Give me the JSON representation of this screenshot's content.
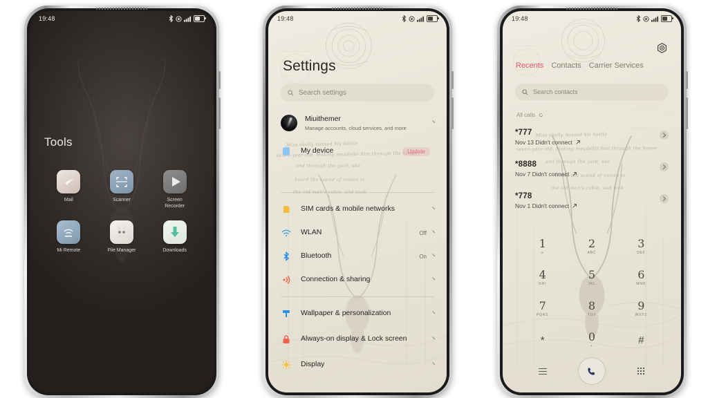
{
  "status_bar": {
    "time": "19:48",
    "icons": [
      "bluetooth-icon",
      "dnd-icon",
      "signal-icon",
      "battery-icon"
    ]
  },
  "phone1": {
    "folder_title": "Tools",
    "apps": [
      {
        "label": "Mail",
        "icon": "mail-icon"
      },
      {
        "label": "Scanner",
        "icon": "scanner-icon"
      },
      {
        "label": "Screen Recorder",
        "icon": "screen-recorder-icon"
      },
      {
        "label": "Mi Remote",
        "icon": "mi-remote-icon"
      },
      {
        "label": "File Manager",
        "icon": "file-manager-icon"
      },
      {
        "label": "Downloads",
        "icon": "downloads-icon"
      }
    ]
  },
  "phone2": {
    "title": "Settings",
    "search_placeholder": "Search settings",
    "account": {
      "name": "Miuithemer",
      "subtitle": "Manage accounts, cloud services, and more"
    },
    "items": [
      {
        "label": "My device",
        "badge": "Update",
        "value": "",
        "icon": "device-icon",
        "color": "#8cc6f0"
      },
      {
        "label": "SIM cards & mobile networks",
        "badge": "",
        "value": "",
        "icon": "sim-icon",
        "color": "#f6bd3b"
      },
      {
        "label": "WLAN",
        "badge": "",
        "value": "Off",
        "icon": "wifi-icon",
        "color": "#4aa8e0"
      },
      {
        "label": "Bluetooth",
        "badge": "",
        "value": "On",
        "icon": "bluetooth-icon",
        "color": "#2b8fe8"
      },
      {
        "label": "Connection & sharing",
        "badge": "",
        "value": "",
        "icon": "connection-sharing-icon",
        "color": "#ef5a3c"
      },
      {
        "label": "Wallpaper & personalization",
        "badge": "",
        "value": "",
        "icon": "wallpaper-icon",
        "color": "#2b8fe8"
      },
      {
        "label": "Always-on display & Lock screen",
        "badge": "",
        "value": "",
        "icon": "lock-icon",
        "color": "#f0614b"
      },
      {
        "label": "Display",
        "badge": "",
        "value": "",
        "icon": "display-icon",
        "color": "#f7c13a"
      }
    ]
  },
  "phone3": {
    "tabs": [
      {
        "label": "Recents",
        "active": true
      },
      {
        "label": "Contacts",
        "active": false
      },
      {
        "label": "Carrier Services",
        "active": false
      }
    ],
    "search_placeholder": "Search contacts",
    "filter_label": "All calls",
    "calls": [
      {
        "number": "*777",
        "detail": "Nov 13 Didn't connect"
      },
      {
        "number": "*8888",
        "detail": "Nov 7 Didn't connect"
      },
      {
        "number": "*778",
        "detail": "Nov 1 Didn't connect"
      }
    ],
    "dialpad": [
      {
        "digit": "1",
        "letters": "∞"
      },
      {
        "digit": "2",
        "letters": "ABC"
      },
      {
        "digit": "3",
        "letters": "DEF"
      },
      {
        "digit": "4",
        "letters": "GHI"
      },
      {
        "digit": "5",
        "letters": "JKL"
      },
      {
        "digit": "6",
        "letters": "MNO"
      },
      {
        "digit": "7",
        "letters": "PQRS"
      },
      {
        "digit": "8",
        "letters": "TUV"
      },
      {
        "digit": "9",
        "letters": "WXYZ"
      },
      {
        "digit": "*",
        "letters": ""
      },
      {
        "digit": "0",
        "letters": "+"
      },
      {
        "digit": "#",
        "letters": ""
      }
    ],
    "bottom_bar": {
      "menu": "menu-icon",
      "call": "call-icon",
      "keypad": "keypad-icon"
    }
  },
  "colors": {
    "accent_red": "#e0566b",
    "badge_pink": "#e06b7e",
    "paper": "#eae6da",
    "dark_wall": "#332e2b"
  },
  "script_lines": [
    "Miss shelly missed his bottle",
    "seven-year-old. Making meadefor him through the house",
    "and through the yard, she",
    "heard the sound of voices in",
    "the old man's cabin, and took"
  ]
}
